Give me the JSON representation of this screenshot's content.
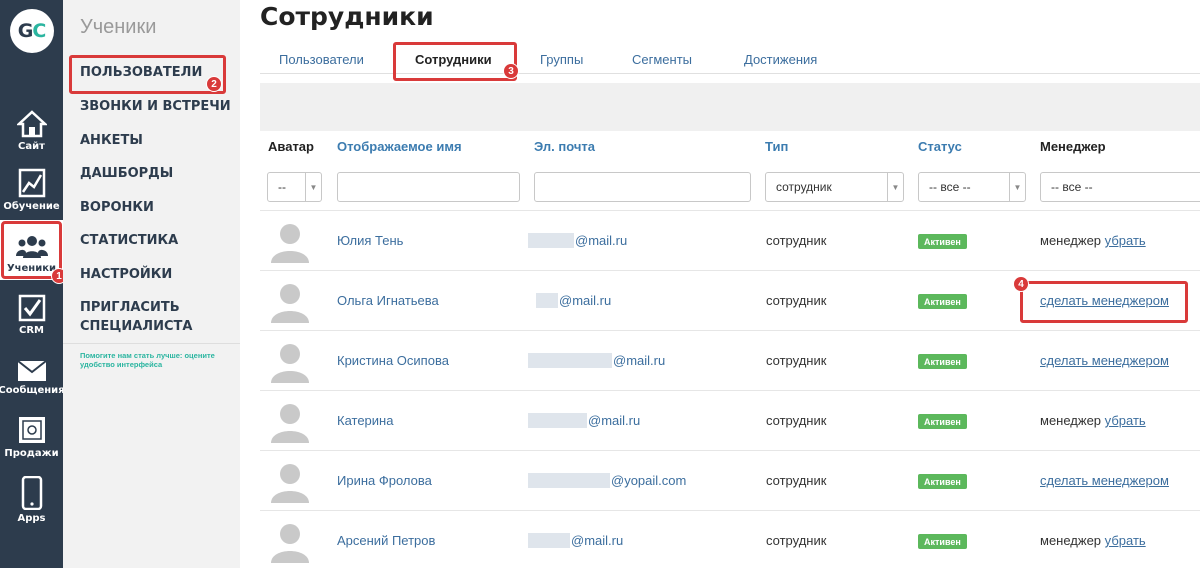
{
  "rail": {
    "items": [
      {
        "label": "Сайт",
        "icon": "house-icon"
      },
      {
        "label": "Обучение",
        "icon": "chart-icon"
      },
      {
        "label": "Ученики",
        "icon": "users-icon",
        "badge": "1"
      },
      {
        "label": "CRM",
        "icon": "checkbox-icon"
      },
      {
        "label": "Сообщения",
        "icon": "envelope-icon"
      },
      {
        "label": "Продажи",
        "icon": "safe-icon"
      },
      {
        "label": "Apps",
        "icon": "phone-icon"
      }
    ]
  },
  "subnav": {
    "title": "Ученики",
    "items": [
      "ПОЛЬЗОВАТЕЛИ",
      "ЗВОНКИ И ВСТРЕЧИ",
      "АНКЕТЫ",
      "ДАШБОРДЫ",
      "ВОРОНКИ",
      "СТАТИСТИКА",
      "НАСТРОЙКИ",
      "ПРИГЛАСИТЬ СПЕЦИАЛИСТА"
    ],
    "badge": "2",
    "note": "Помогите нам стать лучше: оцените удобство интерфейса"
  },
  "page": {
    "title": "Сотрудники"
  },
  "tabs": {
    "items": [
      "Пользователи",
      "Сотрудники",
      "Группы",
      "Сегменты",
      "Достижения"
    ],
    "badge": "3"
  },
  "table": {
    "headers": {
      "avatar": "Аватар",
      "name": "Отображаемое имя",
      "email": "Эл. почта",
      "type": "Тип",
      "status": "Статус",
      "manager": "Менеджер"
    },
    "filters": {
      "avatar": "--",
      "type": "сотрудник",
      "status": "-- все --",
      "manager": "-- все --"
    },
    "rows": [
      {
        "name": "Юлия Тень",
        "email": "@mail.ru",
        "type": "сотрудник",
        "status": "Активен",
        "manager_text": "менеджер",
        "manager_link": "убрать"
      },
      {
        "name": "Ольга Игнатьева",
        "email": "@mail.ru",
        "type": "сотрудник",
        "status": "Активен",
        "manager_text": "",
        "manager_link": "сделать менеджером"
      },
      {
        "name": "Кристина Осипова",
        "email": "@mail.ru",
        "type": "сотрудник",
        "status": "Активен",
        "manager_text": "",
        "manager_link": "сделать менеджером"
      },
      {
        "name": "Катерина",
        "email": "@mail.ru",
        "type": "сотрудник",
        "status": "Активен",
        "manager_text": "менеджер",
        "manager_link": "убрать"
      },
      {
        "name": "Ирина Фролова",
        "email": "@yopail.com",
        "type": "сотрудник",
        "status": "Активен",
        "manager_text": "",
        "manager_link": "сделать менеджером"
      },
      {
        "name": "Арсений Петров",
        "email": "@mail.ru",
        "type": "сотрудник",
        "status": "Активен",
        "manager_text": "менеджер",
        "manager_link": "убрать"
      }
    ],
    "badge": "4"
  },
  "colors": {
    "rail": "#2d3c4d",
    "accent": "#2bb5a0",
    "annotation": "#d93a3a",
    "status_active": "#5cb85c",
    "link": "#3c6e9e"
  }
}
